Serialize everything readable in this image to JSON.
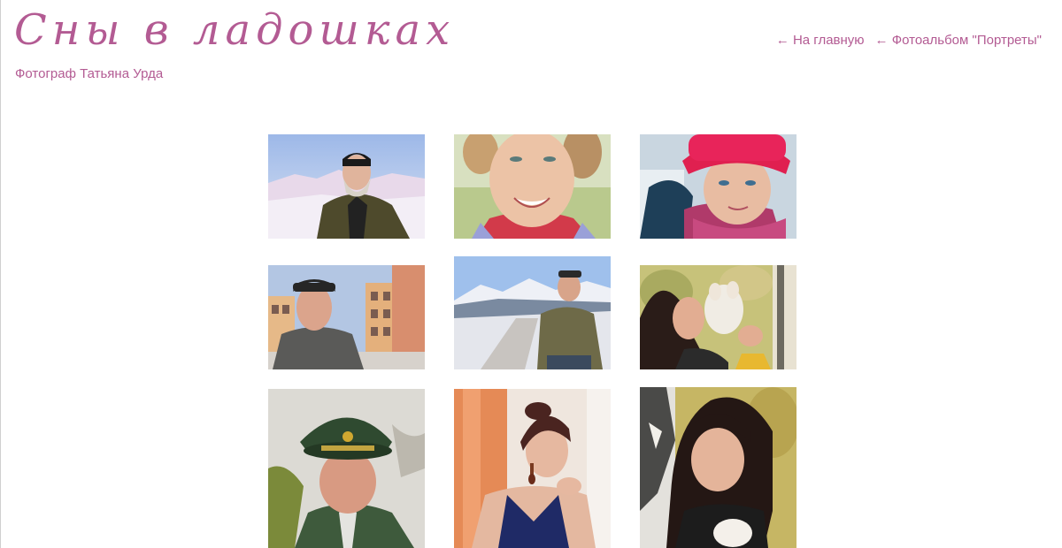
{
  "header": {
    "title": "Сны в ладошках",
    "subtitle": "Фотограф Татьяна Урда"
  },
  "nav": {
    "home_link": "← На главную",
    "album_link": "← Фотоальбом \"Портреты\""
  },
  "colors": {
    "accent": "#b35b93",
    "background": "#ffffff"
  },
  "gallery": {
    "photos": [
      {
        "subject": "bearded man in black cap, snowy mountains"
      },
      {
        "subject": "smiling freckled woman close-up"
      },
      {
        "subject": "woman in red knitted hat and scarf"
      },
      {
        "subject": "man in flat cap, apartment buildings"
      },
      {
        "subject": "man in jacket on snowy road, mountains"
      },
      {
        "subject": "woman kissing small white dog, birch trees"
      },
      {
        "subject": "man in military uniform and peaked cap"
      },
      {
        "subject": "woman with earrings by window, orange curtain"
      },
      {
        "subject": "dark-haired woman with small dog, birch tree"
      }
    ]
  }
}
